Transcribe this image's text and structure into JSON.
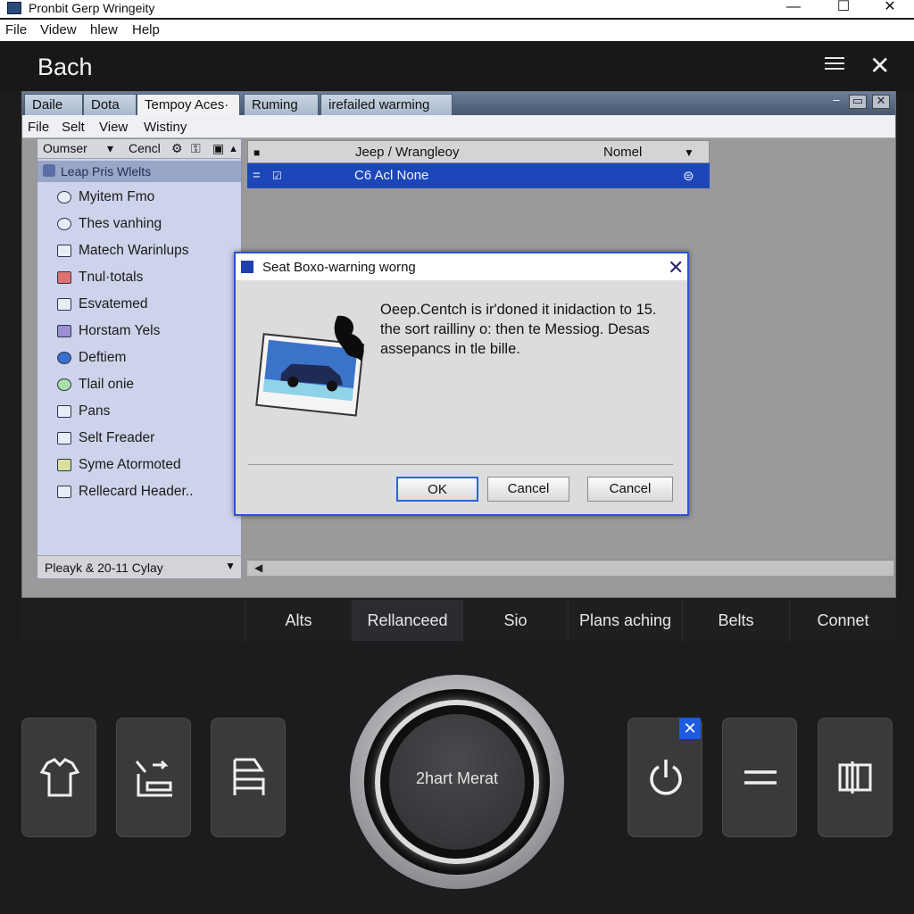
{
  "window": {
    "title": "Pronbit Gerp Wringeity",
    "controls": {
      "minimize": "—",
      "maximize": "☐",
      "close": "✕"
    }
  },
  "menu": [
    "File",
    "Videw",
    "hlew",
    "Help"
  ],
  "app": {
    "title": "Bach",
    "close_glyph": "✕"
  },
  "inner": {
    "tabs": [
      "Daile",
      "Dota",
      "Tempoy Aces·",
      "Ruming",
      "irefailed warming"
    ],
    "window_controls": [
      "–",
      "▭",
      "✕"
    ],
    "menu": [
      "File",
      "Selt",
      "View",
      "Wistiny"
    ]
  },
  "left_panel": {
    "header": {
      "col1": "Oumser",
      "col2": "Cencl"
    },
    "group_label": "Leap Pris Wlelts",
    "items": [
      {
        "label": "Myitem Fmo",
        "icon": "clock-icon"
      },
      {
        "label": "Thes vanhing",
        "icon": "clock-icon"
      },
      {
        "label": "Matech Warinlups",
        "icon": "card-icon"
      },
      {
        "label": "Tnul·totals",
        "icon": "tag-icon"
      },
      {
        "label": "Esvatemed",
        "icon": "window-icon"
      },
      {
        "label": "Horstam Yels",
        "icon": "palette-icon"
      },
      {
        "label": "Deftiem",
        "icon": "globe-icon"
      },
      {
        "label": "Tlail onie",
        "icon": "pin-icon"
      },
      {
        "label": "Pans",
        "icon": "folder-icon"
      },
      {
        "label": "Selt Freader",
        "icon": "image-icon"
      },
      {
        "label": "Syme Atormoted",
        "icon": "grid-icon"
      },
      {
        "label": "Rellecard Header..",
        "icon": "copy-icon"
      }
    ],
    "footer": "Pleayk & 20-11 Cylay",
    "footer_dropdown": "▼"
  },
  "list": {
    "headers": [
      "Jeep / Wrangleoy",
      "Nomel"
    ],
    "row": {
      "name": "C6 Acl None"
    }
  },
  "dialog": {
    "title": "Seat Boxo-warning worng",
    "close_glyph": "✕",
    "message": "Oeep.Centch is ir'doned it inidaction to 15. the sort railliny o: then te Messiog. Desas assepancs in tle bille.",
    "buttons": {
      "ok": "OK",
      "cancel1": "Cancel",
      "cancel2": "Cancel"
    }
  },
  "bottom_nav": [
    "Alts",
    "Rellanceed",
    "Sio",
    "Plans aching",
    "Belts",
    "Connet"
  ],
  "knob": {
    "label": "2hart Merat"
  },
  "badge": "✕",
  "colors": {
    "accent": "#2b55d0",
    "selection": "#1d47b8",
    "background": "#1c1c1e"
  }
}
